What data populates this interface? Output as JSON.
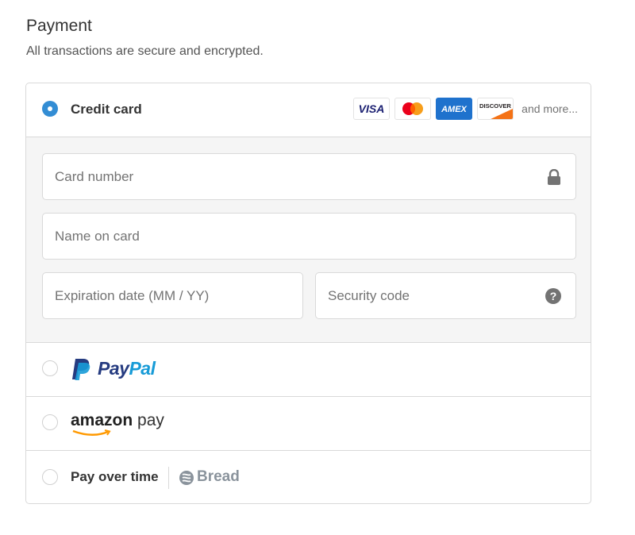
{
  "header": {
    "title": "Payment",
    "subtitle": "All transactions are secure and encrypted."
  },
  "credit_card": {
    "label": "Credit card",
    "selected": true,
    "card_brands": [
      "VISA",
      "mastercard",
      "AMEX",
      "DISCOVER"
    ],
    "and_more": "and more...",
    "fields": {
      "card_number_placeholder": "Card number",
      "name_placeholder": "Name on card",
      "expiration_placeholder": "Expiration date (MM / YY)",
      "security_placeholder": "Security code"
    }
  },
  "paypal": {
    "label_pay": "Pay",
    "label_pal": "Pal",
    "selected": false
  },
  "amazon_pay": {
    "label_amazon": "amazon",
    "label_pay": "pay",
    "selected": false
  },
  "pay_over_time": {
    "label": "Pay over time",
    "provider": "Bread",
    "selected": false
  },
  "colors": {
    "accent": "#338dd4",
    "paypal_dark": "#253b80",
    "paypal_light": "#179bd7",
    "amazon_orange": "#ff9900",
    "bread_grey": "#8a939c"
  }
}
